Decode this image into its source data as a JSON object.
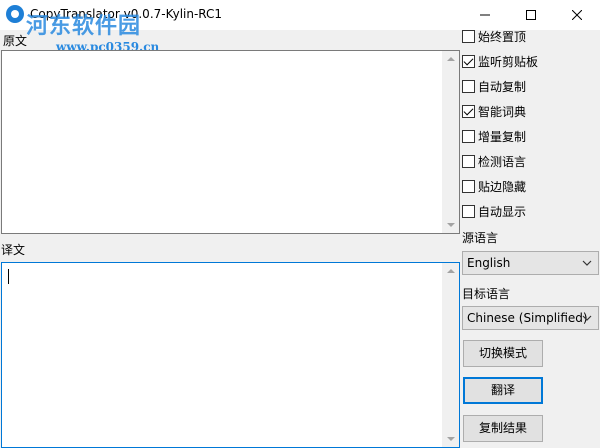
{
  "window": {
    "title": "CopyTranslator v0.0.7-Kylin-RC1",
    "watermark_logo": "河东软件园",
    "watermark_url": "www.pc0359.cn"
  },
  "source": {
    "label": "原文",
    "text": ""
  },
  "output": {
    "label": "译文",
    "text": ""
  },
  "options": [
    {
      "label": "始终置顶",
      "checked": false
    },
    {
      "label": "监听剪贴板",
      "checked": true
    },
    {
      "label": "自动复制",
      "checked": false
    },
    {
      "label": "智能词典",
      "checked": true
    },
    {
      "label": "增量复制",
      "checked": false
    },
    {
      "label": "检测语言",
      "checked": false
    },
    {
      "label": "贴边隐藏",
      "checked": false
    },
    {
      "label": "自动显示",
      "checked": false
    }
  ],
  "source_language": {
    "label": "源语言",
    "value": "English"
  },
  "target_language": {
    "label": "目标语言",
    "value": "Chinese (Simplified)"
  },
  "buttons": {
    "switch_mode": "切换模式",
    "translate": "翻译",
    "copy_result": "复制结果"
  }
}
